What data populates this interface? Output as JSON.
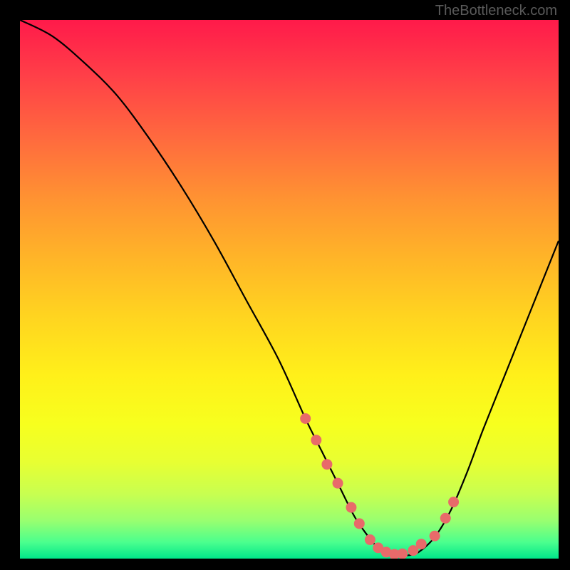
{
  "watermark": "TheBottleneck.com",
  "chart_data": {
    "type": "line",
    "title": "",
    "xlabel": "",
    "ylabel": "",
    "xlim": [
      0,
      100
    ],
    "ylim": [
      0,
      100
    ],
    "series": [
      {
        "name": "bottleneck-curve",
        "x": [
          0,
          6,
          12,
          18,
          24,
          30,
          36,
          42,
          48,
          53,
          56,
          59,
          62,
          64,
          66,
          68,
          70,
          72,
          74,
          77,
          80,
          83,
          86,
          90,
          94,
          100
        ],
        "y": [
          100,
          97,
          92,
          86,
          78,
          69,
          59,
          48,
          37,
          26,
          20,
          14,
          8,
          5,
          2.5,
          1.2,
          0.6,
          0.6,
          1.2,
          4,
          9,
          16,
          24,
          34,
          44,
          59
        ]
      }
    ],
    "markers": {
      "name": "sample-points",
      "x": [
        53,
        55,
        57,
        59,
        61.5,
        63,
        65,
        66.5,
        68,
        69.5,
        71,
        73,
        74.5,
        77,
        79,
        80.5
      ],
      "y": [
        26,
        22,
        17.5,
        14,
        9.5,
        6.5,
        3.5,
        2,
        1.2,
        0.8,
        0.9,
        1.5,
        2.7,
        4.2,
        7.5,
        10.5
      ]
    },
    "gradient_bands": [
      {
        "pos": 0,
        "color": "#ff1a4a"
      },
      {
        "pos": 66,
        "color": "#fff01a"
      },
      {
        "pos": 100,
        "color": "#00e68a"
      }
    ]
  }
}
